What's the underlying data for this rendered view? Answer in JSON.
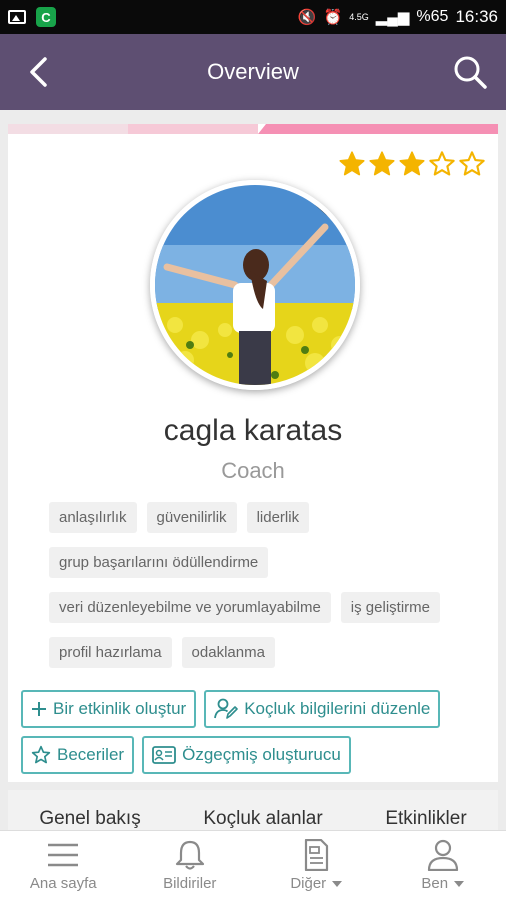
{
  "status_bar": {
    "network": "4.5G",
    "battery": "%65",
    "time": "16:36",
    "app_badge": "C"
  },
  "header": {
    "title": "Overview"
  },
  "profile": {
    "rating": 3,
    "rating_max": 5,
    "name": "cagla karatas",
    "role": "Coach",
    "tags": [
      "anlaşılırlık",
      "güvenilirlik",
      "liderlik",
      "grup başarılarını ödüllendirme",
      "veri düzenleyebilme ve yorumlayabilme",
      "iş geliştirme",
      "profil hazırlama",
      "odaklanma"
    ]
  },
  "actions": {
    "create_event": "Bir etkinlik oluştur",
    "edit_coaching": "Koçluk bilgilerini düzenle",
    "skills": "Beceriler",
    "cv_builder": "Özgeçmiş oluşturucu"
  },
  "tabs": [
    "Genel bakış",
    "Koçluk alanlar",
    "Etkinlikler"
  ],
  "bottom_nav": {
    "home": "Ana sayfa",
    "notifications": "Bildiriler",
    "other": "Diğer",
    "me": "Ben"
  },
  "colors": {
    "header_bg": "#5e4f72",
    "accent_teal": "#58b7b7",
    "star_gold": "#f4b400",
    "strip_pink": "#f8a8c8"
  },
  "icons": {
    "back": "chevron-left-icon",
    "search": "search-icon",
    "star": "star-icon",
    "plus": "plus-icon",
    "edit_user": "user-edit-icon",
    "cv": "id-card-icon",
    "home": "menu-icon",
    "bell": "bell-icon",
    "document": "document-icon",
    "user": "user-icon"
  }
}
